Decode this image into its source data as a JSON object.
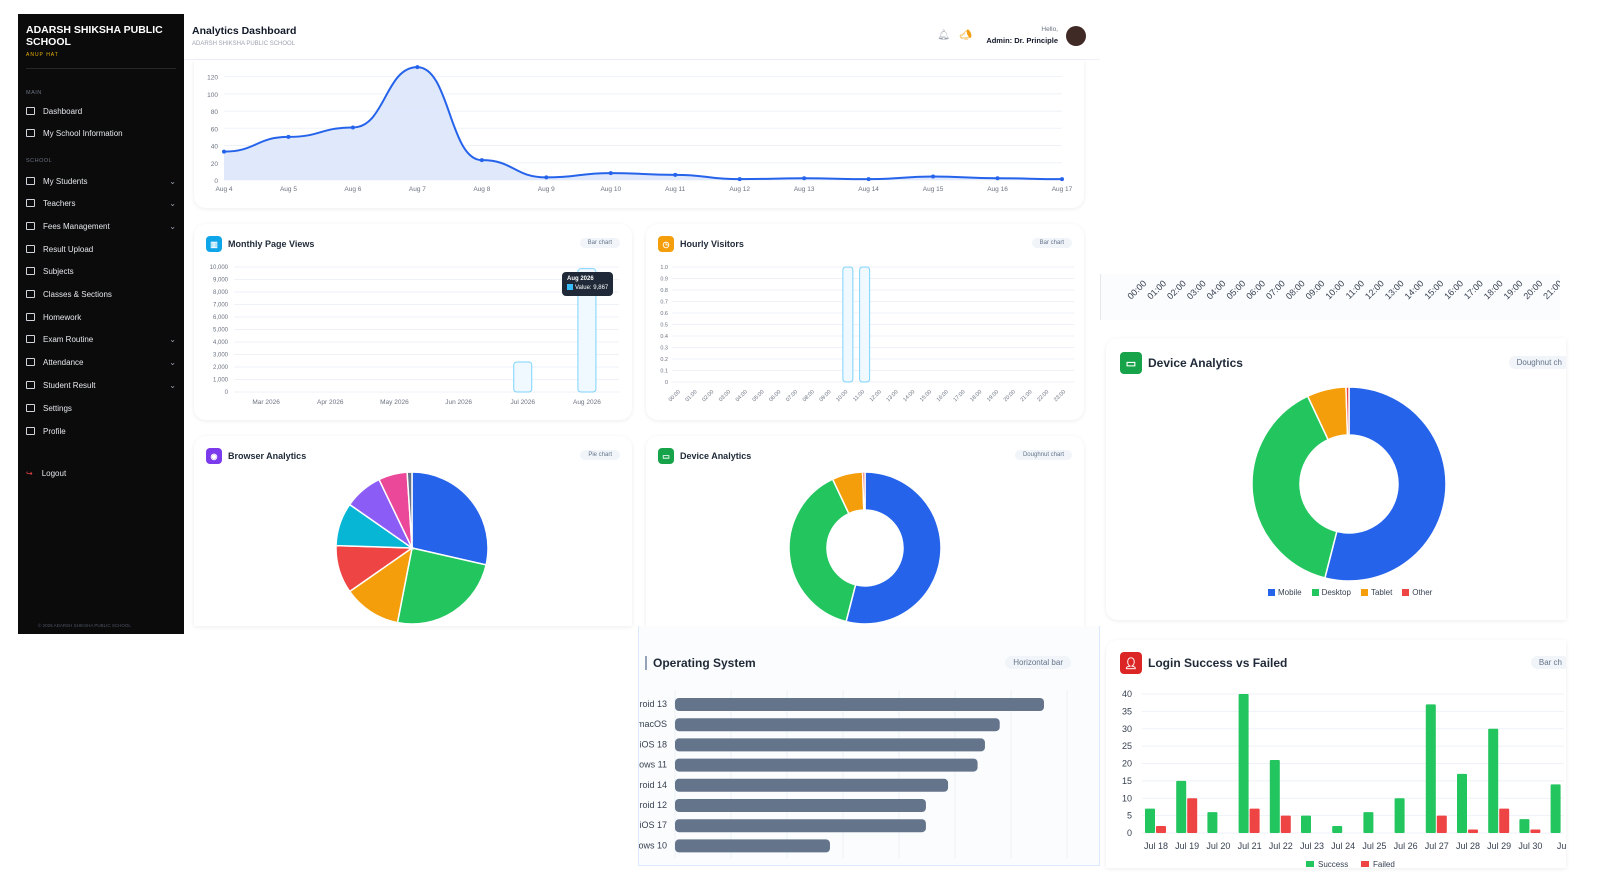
{
  "sidebar": {
    "brand": "ADARSH SHIKSHA PUBLIC SCHOOL",
    "brand_sub": "ANUP HAT",
    "section_main": "MAIN",
    "section_school": "SCHOOL",
    "items": [
      {
        "label": "Dashboard",
        "chevron": false
      },
      {
        "label": "My School Information",
        "chevron": false
      },
      {
        "label": "My Students",
        "chevron": true
      },
      {
        "label": "Teachers",
        "chevron": true
      },
      {
        "label": "Fees Management",
        "chevron": true
      },
      {
        "label": "Result Upload",
        "chevron": false
      },
      {
        "label": "Subjects",
        "chevron": false
      },
      {
        "label": "Classes & Sections",
        "chevron": false
      },
      {
        "label": "Homework",
        "chevron": false
      },
      {
        "label": "Exam Routine",
        "chevron": true
      },
      {
        "label": "Attendance",
        "chevron": true
      },
      {
        "label": "Student Result",
        "chevron": true
      },
      {
        "label": "Settings",
        "chevron": false
      },
      {
        "label": "Profile",
        "chevron": false
      }
    ],
    "logout": "Logout",
    "footer": "© 2026 ADARSH SHIKSHA PUBLIC SCHOOL"
  },
  "header": {
    "title": "Analytics Dashboard",
    "subtitle": "ADARSH SHIKSHA PUBLIC SCHOOL",
    "hello": "Hello,",
    "admin": "Admin: Dr. Principle"
  },
  "cards": {
    "monthly": {
      "title": "Monthly Page Views",
      "badge": "Bar chart",
      "color": "#0ea5e9"
    },
    "hourly": {
      "title": "Hourly Visitors",
      "badge": "Bar chart",
      "color": "#f59e0b"
    },
    "browser": {
      "title": "Browser Analytics",
      "badge": "Pie chart",
      "color": "#7c3aed"
    },
    "device": {
      "title": "Device Analytics",
      "badge": "Doughnut chart",
      "color": "#16a34a"
    },
    "device_big": {
      "title": "Device Analytics",
      "badge": "Doughnut ch"
    },
    "os": {
      "title": "Operating System",
      "badge": "Horizontal bar"
    },
    "login": {
      "title": "Login Success vs Failed",
      "badge": "Bar ch",
      "color": "#dc2626"
    }
  },
  "tooltip": {
    "title": "Aug 2026",
    "value": "Value: 9,867"
  },
  "chart_data": [
    {
      "type": "area",
      "x": [
        "Aug 4",
        "Aug 5",
        "Aug 6",
        "Aug 7",
        "Aug 8",
        "Aug 9",
        "Aug 10",
        "Aug 11",
        "Aug 12",
        "Aug 13",
        "Aug 14",
        "Aug 15",
        "Aug 16",
        "Aug 17"
      ],
      "values": [
        33,
        50,
        61,
        131,
        23,
        3,
        8,
        6,
        1,
        2,
        1,
        4,
        2,
        1
      ],
      "yticks": [
        "0",
        "20",
        "40",
        "60",
        "80",
        "100",
        "120"
      ],
      "ylim": [
        0,
        130
      ],
      "color": "#2563eb"
    },
    {
      "type": "bar",
      "categories": [
        "Mar 2026",
        "Apr 2026",
        "May 2026",
        "Jun 2026",
        "Jul 2026",
        "Aug 2026"
      ],
      "values": [
        0,
        0,
        0,
        0,
        2400,
        9867
      ],
      "yticks": [
        "0",
        "1,000",
        "2,000",
        "3,000",
        "4,000",
        "5,000",
        "6,000",
        "7,000",
        "8,000",
        "9,000",
        "10,000"
      ],
      "ylim": [
        0,
        10000
      ]
    },
    {
      "type": "bar",
      "categories": [
        "00:00",
        "01:00",
        "02:00",
        "03:00",
        "04:00",
        "05:00",
        "06:00",
        "07:00",
        "08:00",
        "09:00",
        "10:00",
        "11:00",
        "12:00",
        "13:00",
        "14:00",
        "15:00",
        "16:00",
        "17:00",
        "18:00",
        "19:00",
        "20:00",
        "21:00",
        "22:00",
        "23:00"
      ],
      "values": [
        0,
        0,
        0,
        0,
        0,
        0,
        0,
        0,
        0,
        0,
        1,
        1,
        0,
        0,
        0,
        0,
        0,
        0,
        0,
        0,
        0,
        0,
        0,
        0
      ],
      "yticks": [
        "0",
        "0.1",
        "0.2",
        "0.3",
        "0.4",
        "0.5",
        "0.6",
        "0.7",
        "0.8",
        "0.9",
        "1.0"
      ],
      "ylim": [
        0,
        1
      ]
    },
    {
      "type": "pie",
      "values": [
        28,
        24,
        12,
        10,
        9,
        8,
        6,
        1
      ],
      "colors": [
        "#2563eb",
        "#22c55e",
        "#f59e0b",
        "#ef4444",
        "#06b6d4",
        "#8b5cf6",
        "#ec4899",
        "#64748b"
      ]
    },
    {
      "type": "pie",
      "categories": [
        "Mobile",
        "Desktop",
        "Tablet",
        "Other"
      ],
      "values": [
        54,
        39,
        6.5,
        0.5
      ],
      "colors": [
        "#2563eb",
        "#22c55e",
        "#f59e0b",
        "#ef4444"
      ]
    },
    {
      "type": "bar",
      "categories": [
        "roid 13",
        "macOS",
        "iOS 18",
        "ows 11",
        "roid 14",
        "roid 12",
        "iOS 17",
        "ows 10"
      ],
      "values": [
        100,
        88,
        84,
        82,
        74,
        68,
        68,
        42
      ],
      "color": "#64748b"
    },
    {
      "type": "bar",
      "categories": [
        "Jul 18",
        "Jul 19",
        "Jul 20",
        "Jul 21",
        "Jul 22",
        "Jul 23",
        "Jul 24",
        "Jul 25",
        "Jul 26",
        "Jul 27",
        "Jul 28",
        "Jul 29",
        "Jul 30",
        "Ju"
      ],
      "series": [
        {
          "name": "Success",
          "values": [
            7,
            15,
            6,
            40,
            21,
            5,
            2,
            6,
            10,
            37,
            17,
            30,
            4,
            14
          ],
          "color": "#22c55e"
        },
        {
          "name": "Failed",
          "values": [
            2,
            10,
            0,
            7,
            5,
            0,
            0,
            0,
            0,
            5,
            1,
            7,
            1,
            0
          ],
          "color": "#ef4444"
        }
      ],
      "yticks": [
        "0",
        "5",
        "10",
        "15",
        "20",
        "25",
        "30",
        "35",
        "40"
      ],
      "ylim": [
        0,
        40
      ]
    }
  ]
}
